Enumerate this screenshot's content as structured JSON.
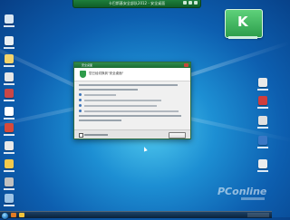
{
  "window": {
    "top_bar_title": "卡巴斯基安全部队2012 - 安全桌面",
    "widget_letter": "K",
    "dialog_title": "安全桌面",
    "dialog_header": "您已经切换到\"安全桌面\""
  },
  "watermark": {
    "text": "PConline"
  },
  "colors": {
    "accent_green": "#2e9b4a",
    "desktop_blue": "#1d8fd3"
  },
  "desktop_icons_left": [
    {
      "icon": "computer-icon"
    },
    {
      "icon": "recycle-bin-icon"
    },
    {
      "icon": "folder-icon"
    },
    {
      "icon": "app-icon"
    },
    {
      "icon": "shortcut-icon"
    },
    {
      "icon": "app-icon"
    },
    {
      "icon": "app-icon"
    },
    {
      "icon": "shortcut-icon"
    },
    {
      "icon": "shortcut-icon"
    },
    {
      "icon": "app-icon"
    },
    {
      "icon": "computer-icon"
    }
  ],
  "desktop_icons_right": [
    {
      "icon": "app-icon"
    },
    {
      "icon": "app-icon"
    },
    {
      "icon": "app-icon"
    },
    {
      "icon": "app-icon"
    },
    {
      "icon": "app-icon"
    }
  ]
}
